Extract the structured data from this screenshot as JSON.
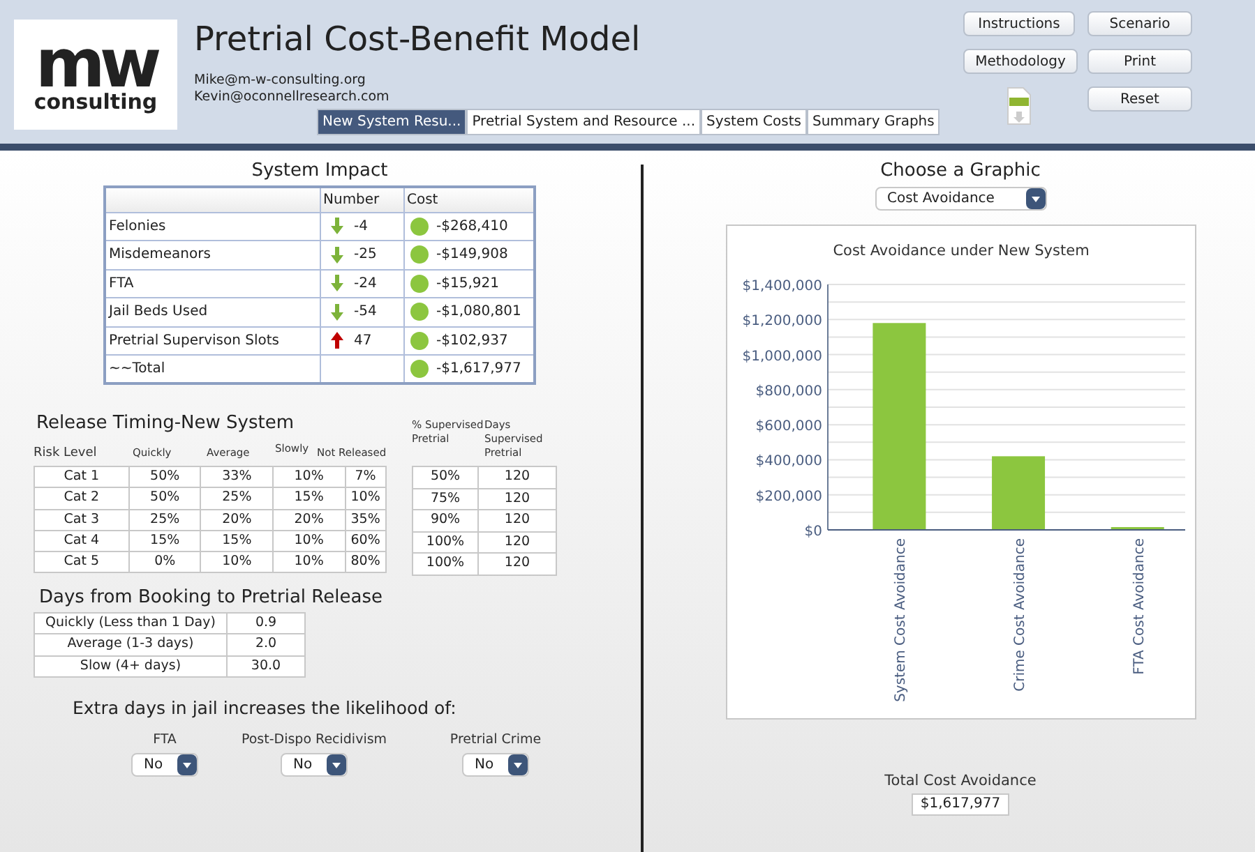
{
  "logo": {
    "mark": "mw",
    "word": "consulting"
  },
  "header": {
    "title": "Pretrial Cost-Benefit Model",
    "contacts": [
      "Mike@m-w-consulting.org",
      "Kevin@oconnellresearch.com"
    ]
  },
  "buttons": [
    "Instructions",
    "Scenario",
    "Methodology",
    "Print",
    "Reset"
  ],
  "tabs": [
    {
      "label": "New System Resu...",
      "selected": true
    },
    {
      "label": "Pretrial System and Resource ...",
      "selected": false
    },
    {
      "label": "System Costs",
      "selected": false
    },
    {
      "label": "Summary Graphs",
      "selected": false
    }
  ],
  "system_impact": {
    "title": "System Impact",
    "columns": [
      "Number",
      "Cost"
    ],
    "rows": [
      {
        "label": "Felonies",
        "kind": "down",
        "number": "-4",
        "cost": "-$268,410",
        "color": "#8cc63f"
      },
      {
        "label": "Misdemeanors",
        "kind": "down",
        "number": "-25",
        "cost": "-$149,908",
        "color": "#8cc63f"
      },
      {
        "label": "FTA",
        "kind": "down",
        "number": "-24",
        "cost": "-$15,921",
        "color": "#8cc63f"
      },
      {
        "label": "Jail Beds Used",
        "kind": "down",
        "number": "-54",
        "cost": "-$1,080,801",
        "color": "#8cc63f"
      },
      {
        "label": "Pretrial Supervison Slots",
        "kind": "up",
        "number": "47",
        "cost": "-$102,937",
        "color": "#8cc63f"
      },
      {
        "label": "~~Total",
        "kind": "none",
        "cost": "-$1,617,977",
        "color": "#8cc63f"
      }
    ]
  },
  "release_timing": {
    "title": "Release Timing-New System",
    "columns": [
      "Risk Level",
      "Quickly",
      "Average",
      "Slowly",
      "Not Released"
    ],
    "rows": [
      [
        "Cat 1",
        "50%",
        "33%",
        "10%",
        "7%"
      ],
      [
        "Cat 2",
        "50%",
        "25%",
        "15%",
        "10%"
      ],
      [
        "Cat 3",
        "25%",
        "20%",
        "20%",
        "35%"
      ],
      [
        "Cat 4",
        "15%",
        "15%",
        "10%",
        "60%"
      ],
      [
        "Cat 5",
        "0%",
        "10%",
        "10%",
        "80%"
      ]
    ],
    "supervision_columns": [
      "% Supervised Pretrial",
      "Days Supervised Pretrial"
    ],
    "supervision_rows": [
      [
        "50%",
        "120"
      ],
      [
        "75%",
        "120"
      ],
      [
        "90%",
        "120"
      ],
      [
        "100%",
        "120"
      ],
      [
        "100%",
        "120"
      ]
    ]
  },
  "days_to_release": {
    "title": "Days from Booking to Pretrial Release",
    "rows": [
      [
        "Quickly (Less than 1 Day)",
        "0.9"
      ],
      [
        "Average (1-3 days)",
        "2.0"
      ],
      [
        "Slow (4+ days)",
        "30.0"
      ]
    ]
  },
  "extra_days": {
    "title": "Extra days in jail increases the likelihood of:",
    "selects": [
      {
        "label": "FTA",
        "value": "No"
      },
      {
        "label": "Post-Dispo Recidivism",
        "value": "No"
      },
      {
        "label": "Pretrial Crime",
        "value": "No"
      }
    ]
  },
  "graphic": {
    "title": "Choose a Graphic",
    "value": "Cost Avoidance",
    "chart_data": {
      "type": "bar",
      "title": "Cost Avoidance under New System",
      "categories": [
        "System Cost Avoidance",
        "Crime Cost Avoidance",
        "FTA Cost Avoidance"
      ],
      "values": [
        1180000,
        420000,
        16000
      ],
      "grid": true,
      "ylim": [
        0,
        1400000
      ],
      "yticks": [
        {
          "value": 0,
          "label": "$0"
        },
        {
          "value": 200000,
          "label": "$200,000"
        },
        {
          "value": 400000,
          "label": "$400,000"
        },
        {
          "value": 600000,
          "label": "$600,000"
        },
        {
          "value": 800000,
          "label": "$800,000"
        },
        {
          "value": 1000000,
          "label": "$1,000,000"
        },
        {
          "value": 1200000,
          "label": "$1,200,000"
        },
        {
          "value": 1400000,
          "label": "$1,400,000"
        }
      ]
    }
  },
  "total": {
    "label": "Total Cost Avoidance",
    "value": "$1,617,977"
  }
}
